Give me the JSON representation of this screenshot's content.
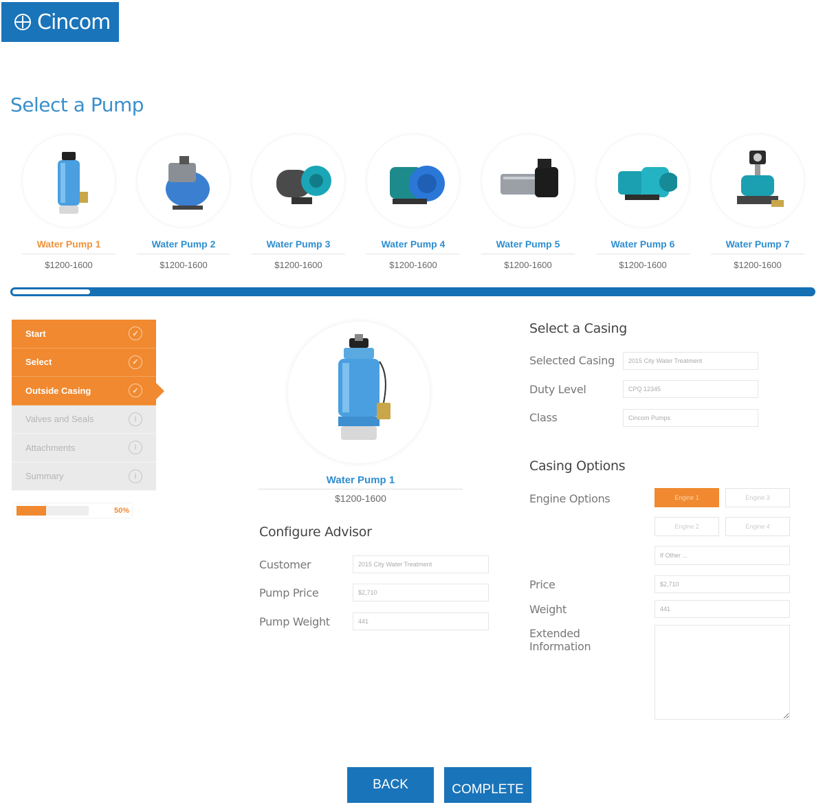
{
  "brand": {
    "name": "Cincom"
  },
  "page": {
    "title": "Select a Pump"
  },
  "pumps": [
    {
      "name": "Water Pump 1",
      "price": "$1200-1600",
      "selected": true,
      "icon": "submersible-pump-icon"
    },
    {
      "name": "Water Pump 2",
      "price": "$1200-1600",
      "selected": false,
      "icon": "pressure-tank-pump-icon"
    },
    {
      "name": "Water Pump 3",
      "price": "$1200-1600",
      "selected": false,
      "icon": "jet-pump-icon"
    },
    {
      "name": "Water Pump 4",
      "price": "$1200-1600",
      "selected": false,
      "icon": "centrifugal-pump-icon"
    },
    {
      "name": "Water Pump 5",
      "price": "$1200-1600",
      "selected": false,
      "icon": "multistage-pump-icon"
    },
    {
      "name": "Water Pump 6",
      "price": "$1200-1600",
      "selected": false,
      "icon": "booster-pump-icon"
    },
    {
      "name": "Water Pump 7",
      "price": "$1200-1600",
      "selected": false,
      "icon": "pump-with-controller-icon"
    }
  ],
  "steps": [
    {
      "label": "Start",
      "status": "done"
    },
    {
      "label": "Select",
      "status": "done"
    },
    {
      "label": "Outside Casing",
      "status": "current"
    },
    {
      "label": "Valves and Seals",
      "status": "todo"
    },
    {
      "label": "Attachments",
      "status": "todo"
    },
    {
      "label": "Summary",
      "status": "todo"
    }
  ],
  "progress": {
    "percent": 50,
    "label": "50%"
  },
  "selected_pump": {
    "name": "Water Pump 1",
    "price": "$1200-1600"
  },
  "configure": {
    "title": "Configure Advisor",
    "customer_label": "Customer",
    "customer_value": "2015 City Water Treatment",
    "price_label": "Pump Price",
    "price_value": "$2,710",
    "weight_label": "Pump Weight",
    "weight_value": "441"
  },
  "casing": {
    "title": "Select a Casing",
    "selected_label": "Selected Casing",
    "selected_value": "2015 City Water Treatment",
    "duty_label": "Duty Level",
    "duty_value": "CPQ 12345",
    "class_label": "Class",
    "class_value": "Cincom Pumps"
  },
  "casing_options": {
    "title": "Casing Options",
    "engine_label": "Engine Options",
    "engines": [
      "Engine 1",
      "Engine 3",
      "Engine 2",
      "Engine 4"
    ],
    "other_value": "If Other ...",
    "price_label": "Price",
    "price_value": "$2,710",
    "weight_label": "Weight",
    "weight_value": "441",
    "extended_label_1": "Extended",
    "extended_label_2": "Information"
  },
  "actions": {
    "back": "BACK",
    "complete": "COMPLETE"
  },
  "colors": {
    "blue": "#1a74ba",
    "orange": "#f0892f",
    "link_blue": "#2e8ed0"
  }
}
